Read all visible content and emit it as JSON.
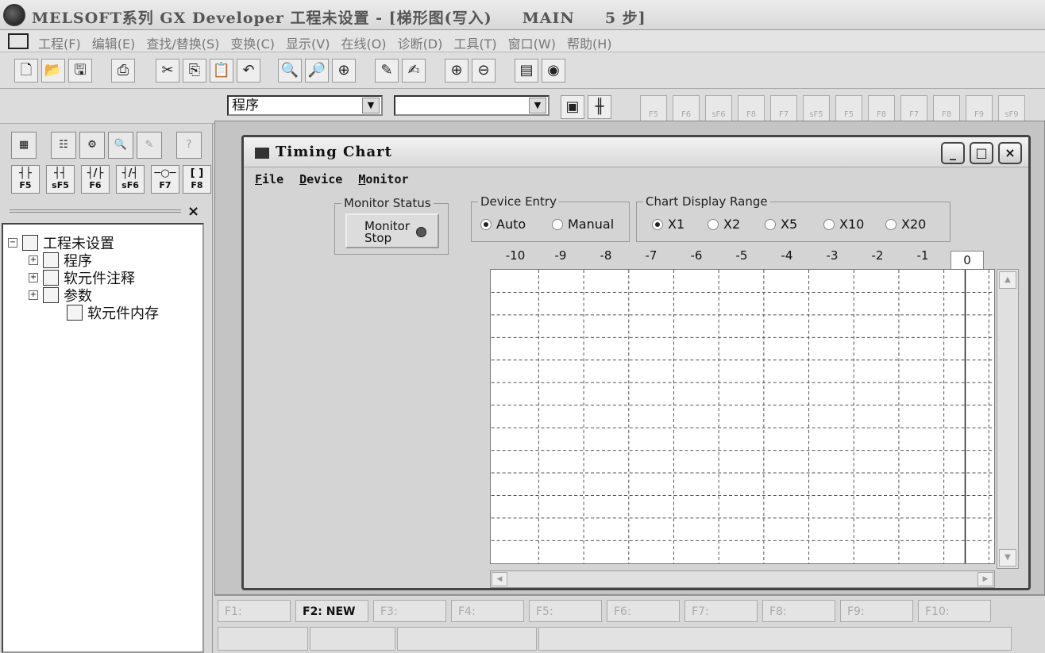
{
  "app": {
    "title": "MELSOFT系列 GX Developer 工程未设置 - [梯形图(写入)     MAIN     5 步]"
  },
  "menu": {
    "items": [
      "工程(F)",
      "编辑(E)",
      "查找/替换(S)",
      "变换(C)",
      "显示(V)",
      "在线(O)",
      "诊断(D)",
      "工具(T)",
      "窗口(W)",
      "帮助(H)"
    ]
  },
  "toolbar1": {
    "buttons": [
      {
        "name": "new-icon",
        "glyph": "🗋"
      },
      {
        "name": "open-icon",
        "glyph": "📂"
      },
      {
        "name": "save-icon",
        "glyph": "🖫"
      },
      {
        "name": "print-icon",
        "glyph": "⎙"
      },
      {
        "name": "cut-icon",
        "glyph": "✂"
      },
      {
        "name": "copy-icon",
        "glyph": "⎘"
      },
      {
        "name": "paste-icon",
        "glyph": "📋"
      },
      {
        "name": "undo-icon",
        "glyph": "↶"
      },
      {
        "name": "find-icon",
        "glyph": "🔍"
      },
      {
        "name": "find-device-icon",
        "glyph": "🔎"
      },
      {
        "name": "find-instruction-icon",
        "glyph": "⊕"
      },
      {
        "name": "write-icon",
        "glyph": "✎"
      },
      {
        "name": "comment-icon",
        "glyph": "✍"
      },
      {
        "name": "zoom-in-icon",
        "glyph": "⊕"
      },
      {
        "name": "zoom-out-icon",
        "glyph": "⊖"
      },
      {
        "name": "plc-icon",
        "glyph": "▤"
      },
      {
        "name": "monitor-icon",
        "glyph": "◉"
      }
    ]
  },
  "toolbar2": {
    "program_combo": "程序",
    "second_combo": "",
    "fkeys": [
      "F5",
      "F6",
      "sF6",
      "F8",
      "F7",
      "sF5",
      "F5",
      "F8",
      "F7",
      "F8",
      "F9",
      "sF9"
    ]
  },
  "leftpanel": {
    "ladder_buttons": [
      {
        "label": "┤├",
        "key": "F5"
      },
      {
        "label": "┤┤",
        "key": "sF5"
      },
      {
        "label": "┤/├",
        "key": "F6"
      },
      {
        "label": "┤/┤",
        "key": "sF6"
      },
      {
        "label": "─○─",
        "key": "F7"
      },
      {
        "label": "[ ]",
        "key": "F8"
      }
    ],
    "close_glyph": "×",
    "tree": {
      "root": "工程未设置",
      "children": [
        "程序",
        "软元件注释",
        "参数",
        "软元件内存"
      ]
    }
  },
  "timing_chart": {
    "title": "Timing Chart",
    "menu": [
      "File",
      "Device",
      "Monitor"
    ],
    "monitor_status": {
      "legend": "Monitor Status",
      "button_line1": "Monitor",
      "button_line2": "Stop"
    },
    "device_entry": {
      "legend": "Device Entry",
      "options": [
        "Auto",
        "Manual"
      ],
      "selected": "Auto"
    },
    "display_range": {
      "legend": "Chart Display Range",
      "options": [
        "X1",
        "X2",
        "X5",
        "X10",
        "X20"
      ],
      "selected": "X1"
    },
    "time_ticks": [
      "-10",
      "-9",
      "-8",
      "-7",
      "-6",
      "-5",
      "-4",
      "-3",
      "-2",
      "-1"
    ],
    "current_tick": "0",
    "window_buttons": [
      "_",
      "□",
      "×"
    ]
  },
  "function_keys": [
    {
      "label": "F1:",
      "active": false
    },
    {
      "label": "F2: NEW",
      "active": true
    },
    {
      "label": "F3:",
      "active": false
    },
    {
      "label": "F4:",
      "active": false
    },
    {
      "label": "F5:",
      "active": false
    },
    {
      "label": "F6:",
      "active": false
    },
    {
      "label": "F7:",
      "active": false
    },
    {
      "label": "F8:",
      "active": false
    },
    {
      "label": "F9:",
      "active": false
    },
    {
      "label": "F10:",
      "active": false
    }
  ]
}
